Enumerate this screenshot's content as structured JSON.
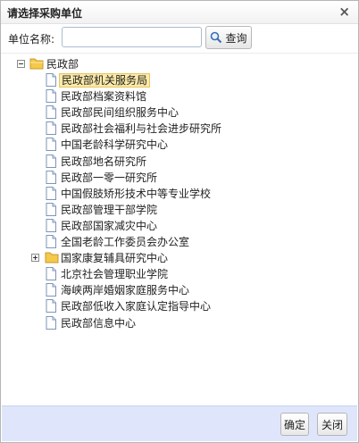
{
  "dialog": {
    "title": "请选择采购单位",
    "close_glyph": "×"
  },
  "search": {
    "label": "单位名称:",
    "value": "",
    "placeholder": "",
    "button_label": "查询",
    "button_icon": "search-icon"
  },
  "tree": {
    "root": {
      "label": "民政部",
      "expanded": true,
      "icon": "folder-icon"
    },
    "children": [
      {
        "label": "民政部机关服务局",
        "selected": true,
        "type": "file"
      },
      {
        "label": "民政部档案资料馆",
        "type": "file"
      },
      {
        "label": "民政部民间组织服务中心",
        "type": "file"
      },
      {
        "label": "民政部社会福利与社会进步研究所",
        "type": "file"
      },
      {
        "label": "中国老龄科学研究中心",
        "type": "file"
      },
      {
        "label": "民政部地名研究所",
        "type": "file"
      },
      {
        "label": "民政部一零一研究所",
        "type": "file"
      },
      {
        "label": "中国假肢矫形技术中等专业学校",
        "type": "file"
      },
      {
        "label": "民政部管理干部学院",
        "type": "file"
      },
      {
        "label": "民政部国家减灾中心",
        "type": "file"
      },
      {
        "label": "全国老龄工作委员会办公室",
        "type": "file"
      },
      {
        "label": "国家康复辅具研究中心",
        "type": "folder",
        "expanded": false
      },
      {
        "label": "北京社会管理职业学院",
        "type": "file"
      },
      {
        "label": "海峡两岸婚姻家庭服务中心",
        "type": "file"
      },
      {
        "label": "民政部低收入家庭认定指导中心",
        "type": "file"
      },
      {
        "label": "民政部信息中心",
        "type": "file"
      }
    ]
  },
  "footer": {
    "confirm_label": "确定",
    "close_label": "关闭"
  },
  "colors": {
    "footer_bg": "#dfe6fb",
    "selected_bg": "#fbeaa8",
    "folder": "#f5c94a"
  }
}
